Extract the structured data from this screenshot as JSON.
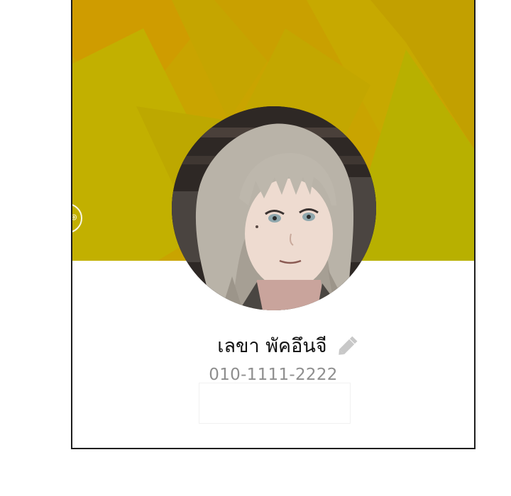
{
  "profile": {
    "name": "เลขา พัคอึนจี",
    "phone": "010-1111-2222",
    "status_message": ""
  },
  "icons": {
    "edit": "pencil-icon",
    "side_button": "camera-icon"
  },
  "colors": {
    "cover_base": "#c9a400",
    "cover_orange": "#d4a000",
    "cover_yellow": "#bdb000",
    "edit_icon": "#c8c8c8",
    "phone_text": "#8e8e8e",
    "frame_border": "#1e1e1e"
  }
}
